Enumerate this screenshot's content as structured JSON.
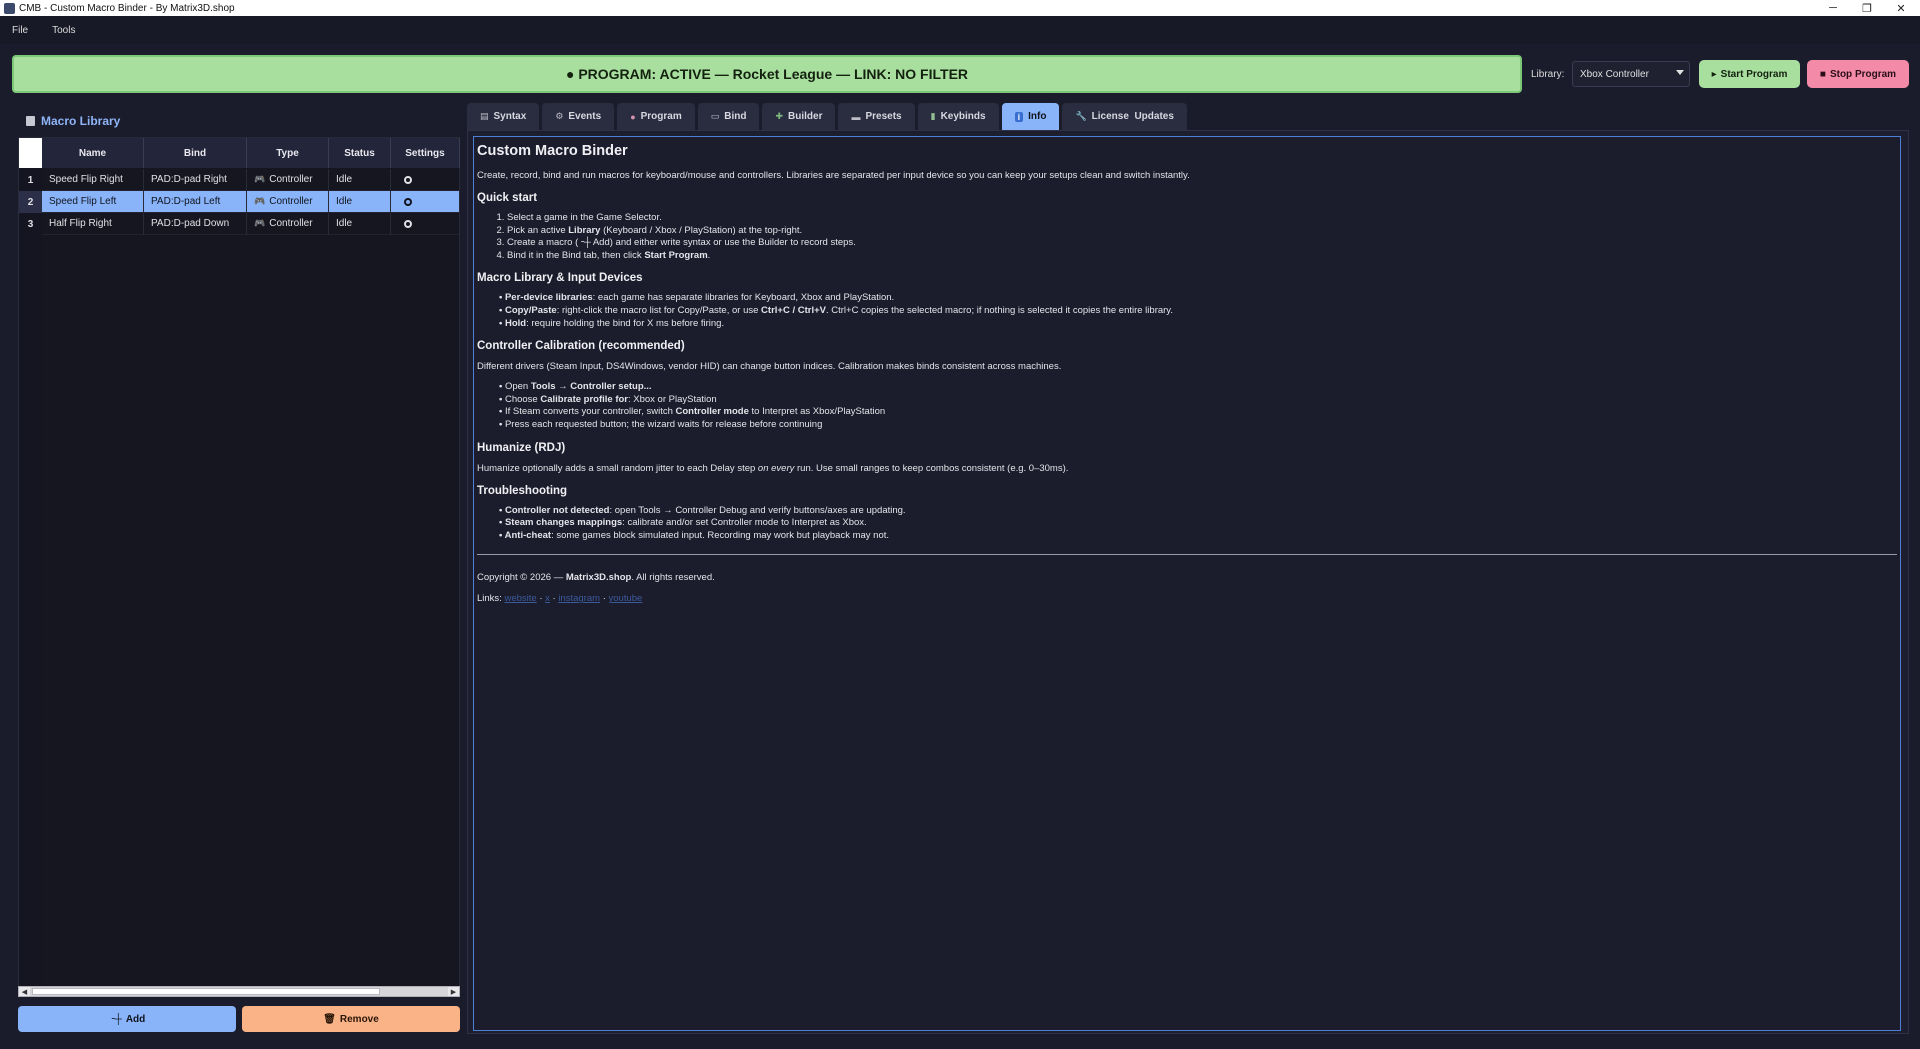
{
  "window": {
    "title": "CMB - Custom Macro Binder - By Matrix3D.shop",
    "controls": {
      "minimize": "─",
      "restore": "❐",
      "close": "✕"
    }
  },
  "menu": [
    "File",
    "Tools"
  ],
  "status": {
    "text": "● PROGRAM: ACTIVE — Rocket League — LINK: NO FILTER",
    "color": "#a8df9f"
  },
  "library": {
    "label": "Library:",
    "selected": "Xbox Controller"
  },
  "actions": {
    "start": "Start Program",
    "stop": "Stop Program"
  },
  "macro_library": {
    "title": "Macro Library",
    "columns": [
      "Name",
      "Bind",
      "Type",
      "Status",
      "Settings"
    ],
    "rows": [
      {
        "num": "1",
        "name": "Speed Flip Right",
        "bind": "PAD:D-pad Right",
        "type": "Controller",
        "status": "Idle"
      },
      {
        "num": "2",
        "name": "Speed Flip Left",
        "bind": "PAD:D-pad Left",
        "type": "Controller",
        "status": "Idle"
      },
      {
        "num": "3",
        "name": "Half Flip Right",
        "bind": "PAD:D-pad Down",
        "type": "Controller",
        "status": "Idle"
      }
    ],
    "selected_row": 1,
    "add": "Add",
    "remove": "Remove"
  },
  "tabs": [
    {
      "label": "Syntax",
      "icon": "document-icon"
    },
    {
      "label": "Events",
      "icon": "gear-icon"
    },
    {
      "label": "Program",
      "icon": "brain-icon"
    },
    {
      "label": "Bind",
      "icon": "keyboard-icon"
    },
    {
      "label": "Builder",
      "icon": "puzzle-icon"
    },
    {
      "label": "Presets",
      "icon": "gamepad-icon"
    },
    {
      "label": "Keybinds",
      "icon": "book-icon"
    },
    {
      "label": "Info",
      "icon": "info-icon",
      "active": true
    },
    {
      "label": "License  Updates",
      "icon": "wrench-icon"
    }
  ],
  "info": {
    "title": "Custom Macro Binder",
    "intro": "Create, record, bind and run macros for keyboard/mouse and controllers. Libraries are separated per input device so you can keep your setups clean and switch instantly.",
    "quick_start": {
      "heading": "Quick start",
      "s1": "Select a game in the Game Selector.",
      "s2a": "Pick an active ",
      "s2b": "Library",
      "s2c": " (Keyboard / Xbox / PlayStation) at the top-right.",
      "s3": "Create a macro (╶┼ Add) and either write syntax or use the Builder to record steps.",
      "s4a": "Bind it in the Bind tab, then click ",
      "s4b": "Start Program",
      "s4c": "."
    },
    "devices": {
      "heading": "Macro Library & Input Devices",
      "b1a": "Per-device libraries",
      "b1b": ": each game has separate libraries for Keyboard, Xbox and PlayStation.",
      "b2a": "Copy/Paste",
      "b2b": ": right-click the macro list for Copy/Paste, or use ",
      "b2c": "Ctrl+C / Ctrl+V",
      "b2d": ". Ctrl+C copies the selected macro; if nothing is selected it copies the entire library.",
      "b3a": "Hold",
      "b3b": ": require holding the bind for X ms before firing."
    },
    "calibration": {
      "heading": "Controller Calibration (recommended)",
      "intro": "Different drivers (Steam Input, DS4Windows, vendor HID) can change button indices. Calibration makes binds consistent across machines.",
      "b1a": "Open ",
      "b1b": "Tools → Controller setup...",
      "b2a": "Choose ",
      "b2b": "Calibrate profile for",
      "b2c": ": Xbox or PlayStation",
      "b3a": "If Steam converts your controller, switch ",
      "b3b": "Controller mode",
      "b3c": " to Interpret as Xbox/PlayStation",
      "b4": "Press each requested button; the wizard waits for release before continuing"
    },
    "humanize": {
      "heading": "Humanize (RDJ)",
      "t1": "Humanize optionally adds a small random jitter to each Delay step ",
      "t2": "on every",
      "t3": " run. Use small ranges to keep combos consistent (e.g. 0–30ms)."
    },
    "troubleshooting": {
      "heading": "Troubleshooting",
      "b1a": "Controller not detected",
      "b1b": ": open Tools → Controller Debug and verify buttons/axes are updating.",
      "b2a": "Steam changes mappings",
      "b2b": ": calibrate and/or set Controller mode to Interpret as Xbox.",
      "b3a": "Anti-cheat",
      "b3b": ": some games block simulated input. Recording may work but playback may not."
    },
    "copyright": {
      "a": "Copyright © 2026 — ",
      "b": "Matrix3D.shop",
      "c": ". All rights reserved."
    },
    "links": {
      "label": "Links: ",
      "l1": "website",
      "sep": " · ",
      "l2": "x",
      "l3": "instagram",
      "l4": "youtube"
    }
  }
}
